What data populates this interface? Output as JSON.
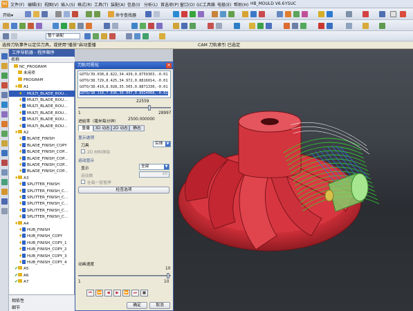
{
  "menubar": {
    "logo": "NX",
    "items": [
      "文件(F)",
      "编辑(E)",
      "视图(V)",
      "插入(S)",
      "格式(R)",
      "工具(T)",
      "装配(A)",
      "信息(I)",
      "分析(L)",
      "首选项(P)",
      "窗口(O)",
      "GC工具箱",
      "电极(E)",
      "帮助(H)",
      "HB_MOULD V6.6",
      "YSUC"
    ]
  },
  "toolbar1": {
    "start_label": "开始▾",
    "command_finder": "命令查找器"
  },
  "toolbar2": {
    "filter_value": "整个装配"
  },
  "cue": {
    "left": "选择刀轨事件以定位刀具，或使用\"播放\"启动重播",
    "right": "CAM 刀轨索引 已选定"
  },
  "navigator": {
    "title": "工序导航器 - 程序顺序",
    "column": "名称",
    "rows": [
      {
        "label": "NC_PROGRAM",
        "indent": 0,
        "type": "root",
        "status": ""
      },
      {
        "label": "未用项",
        "indent": 1,
        "type": "group",
        "status": ""
      },
      {
        "label": "PROGRAM",
        "indent": 1,
        "type": "group",
        "status": ""
      },
      {
        "label": "A1",
        "indent": 1,
        "type": "group",
        "status": "key"
      },
      {
        "label": "MULTI_BLADE_ROU...",
        "indent": 2,
        "type": "op",
        "status": "key",
        "selected": true
      },
      {
        "label": "MULTI_BLADE_ROU...",
        "indent": 2,
        "type": "op",
        "status": "key"
      },
      {
        "label": "MULTI_BLADE_ROU...",
        "indent": 2,
        "type": "op",
        "status": "key"
      },
      {
        "label": "MULTI_BLADE_ROU...",
        "indent": 2,
        "type": "op",
        "status": "key"
      },
      {
        "label": "MULTI_BLADE_ROU...",
        "indent": 2,
        "type": "op",
        "status": "key"
      },
      {
        "label": "MULTI_BLADE_ROU...",
        "indent": 2,
        "type": "op",
        "status": "key"
      },
      {
        "label": "A2",
        "indent": 1,
        "type": "group",
        "status": "key"
      },
      {
        "label": "BLADE_FINISH",
        "indent": 2,
        "type": "op",
        "status": "key"
      },
      {
        "label": "BLADE_FINISH_COPY",
        "indent": 2,
        "type": "op",
        "status": "key"
      },
      {
        "label": "BLADE_FINISH_COP...",
        "indent": 2,
        "type": "op",
        "status": "key"
      },
      {
        "label": "BLADE_FINISH_COP...",
        "indent": 2,
        "type": "op",
        "status": "key"
      },
      {
        "label": "BLADE_FINISH_COP...",
        "indent": 2,
        "type": "op",
        "status": "key"
      },
      {
        "label": "BLADE_FINISH_COP...",
        "indent": 2,
        "type": "op",
        "status": "key"
      },
      {
        "label": "A3",
        "indent": 1,
        "type": "group",
        "status": "key"
      },
      {
        "label": "SPLITTER_FINISH",
        "indent": 2,
        "type": "op",
        "status": "key"
      },
      {
        "label": "SPLITTER_FINISH_C...",
        "indent": 2,
        "type": "op",
        "status": "key"
      },
      {
        "label": "SPLITTER_FINISH_C...",
        "indent": 2,
        "type": "op",
        "status": "key"
      },
      {
        "label": "SPLITTER_FINISH_C...",
        "indent": 2,
        "type": "op",
        "status": "key"
      },
      {
        "label": "SPLITTER_FINISH_C...",
        "indent": 2,
        "type": "op",
        "status": "key"
      },
      {
        "label": "SPLITTER_FINISH_C...",
        "indent": 2,
        "type": "op",
        "status": "key"
      },
      {
        "label": "A4",
        "indent": 1,
        "type": "group",
        "status": "key"
      },
      {
        "label": "HUB_FINISH",
        "indent": 2,
        "type": "op",
        "status": "key"
      },
      {
        "label": "HUB_FINISH_COPY",
        "indent": 2,
        "type": "op",
        "status": "key"
      },
      {
        "label": "HUB_FINISH_COPY_1",
        "indent": 2,
        "type": "op",
        "status": "key"
      },
      {
        "label": "HUB_FINISH_COPY_2",
        "indent": 2,
        "type": "op",
        "status": "key"
      },
      {
        "label": "HUB_FINISH_COPY_3",
        "indent": 2,
        "type": "op",
        "status": "key"
      },
      {
        "label": "HUB_FINISH_COPY_4",
        "indent": 2,
        "type": "op",
        "status": "key"
      },
      {
        "label": "A5",
        "indent": 1,
        "type": "group",
        "status": "check"
      },
      {
        "label": "A6",
        "indent": 1,
        "type": "group",
        "status": "check"
      },
      {
        "label": "A7",
        "indent": 1,
        "type": "group",
        "status": "check"
      }
    ],
    "details": [
      "相依性",
      "细节"
    ]
  },
  "dialog": {
    "title": "刀轨可视化",
    "goto_lines": [
      "GOTO/39.038,8.822,34.439,0.8759303,-0.01",
      "GOTO/38.729,8.425,34.972,0.8816014,-0.01",
      "GOTO/38.419,8.028,35.505,0.8871330,-0.01",
      "GOTO/38.118,7.636,36.047,0.8924008,-0.02"
    ],
    "slider_current": "22559",
    "slider_min": "1",
    "slider_max": "28997",
    "slider_fraction": 0.778,
    "feed_label": "进给率（毫米每分钟）",
    "feed_value": "2500.000000",
    "tabs": [
      "重播",
      "3D 动态",
      "2D 动态",
      "静态"
    ],
    "display_options_label": "显示选项",
    "tool_label": "刀具",
    "tool_value": "实体",
    "toolpath_2d": "2D 材料移除",
    "motion_display_label": "运动显示",
    "display_label": "显示",
    "display_value": "全部",
    "motion_count_label": "运动数",
    "motion_count_value": "10",
    "prev_op_label": "在每一层暂停",
    "check_button": "检查选项",
    "anim_speed_label": "动画速度",
    "anim_speed_min": "1",
    "anim_speed_max": "10",
    "anim_speed_value": "10",
    "vcr_buttons": [
      "⏮",
      "⏪",
      "◀",
      "▶",
      "⏩",
      "⏭",
      "■"
    ],
    "ok": "确定",
    "cancel": "取消"
  },
  "colors": {
    "accent": "#2452b0",
    "part_red": "#d8363f",
    "toolpath_green": "#2ed62e"
  }
}
